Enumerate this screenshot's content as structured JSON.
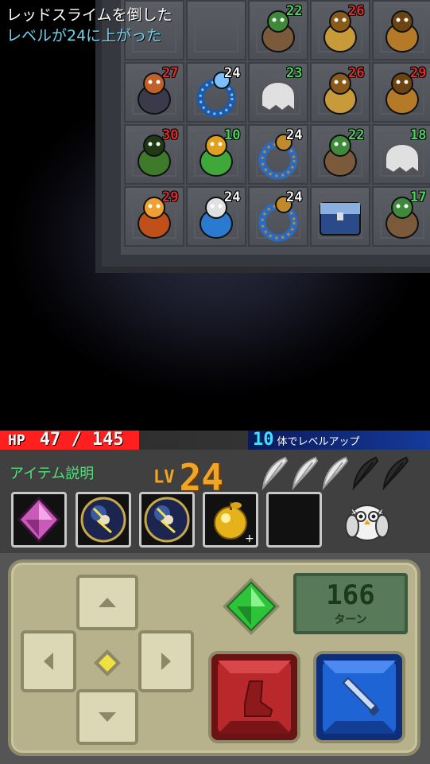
{
  "log": [
    "レッドスライムを倒した",
    "レベルが24に上がった"
  ],
  "board": {
    "monsters": [
      {
        "name": "ratman",
        "num": "22",
        "color": "green",
        "col": 2,
        "row": 0
      },
      {
        "name": "owlbear",
        "num": "26",
        "color": "red",
        "col": 3,
        "row": 0
      },
      {
        "name": "mud-slime",
        "num": "",
        "color": "",
        "col": 4,
        "row": 0
      },
      {
        "name": "dark-knight",
        "num": "27",
        "color": "red",
        "col": 0,
        "row": 1
      },
      {
        "name": "sea-serpent",
        "num": "24",
        "color": "white",
        "col": 1,
        "row": 1
      },
      {
        "name": "ghost",
        "num": "23",
        "color": "green",
        "col": 2,
        "row": 1
      },
      {
        "name": "owlbear",
        "num": "26",
        "color": "red",
        "col": 3,
        "row": 1
      },
      {
        "name": "mud-slime",
        "num": "29",
        "color": "red",
        "col": 4,
        "row": 1
      },
      {
        "name": "hooded-mage",
        "num": "30",
        "color": "red",
        "col": 0,
        "row": 2
      },
      {
        "name": "green-frog",
        "num": "10",
        "color": "green",
        "col": 1,
        "row": 2
      },
      {
        "name": "snail",
        "num": "24",
        "color": "white",
        "col": 2,
        "row": 2
      },
      {
        "name": "ratman",
        "num": "22",
        "color": "green",
        "col": 3,
        "row": 2
      },
      {
        "name": "ghost",
        "num": "18",
        "color": "green",
        "col": 4,
        "row": 2
      },
      {
        "name": "fire-golem",
        "num": "29",
        "color": "red",
        "col": 0,
        "row": 3
      },
      {
        "name": "hero",
        "num": "24",
        "color": "white",
        "col": 1,
        "row": 3
      },
      {
        "name": "snail",
        "num": "24",
        "color": "white",
        "col": 2,
        "row": 3
      },
      {
        "name": "treasure-chest",
        "num": "",
        "color": "",
        "col": 3,
        "row": 3
      },
      {
        "name": "ratman",
        "num": "17",
        "color": "green",
        "col": 4,
        "row": 3
      }
    ]
  },
  "status": {
    "hp_label": "HP",
    "hp_current": "47",
    "hp_sep": "/",
    "hp_max": "145",
    "hp_fraction": 0.324,
    "levelup_count": "10",
    "levelup_text": "体でレベルアップ"
  },
  "info": {
    "item_desc": "アイテム説明",
    "lv_label": "LV",
    "lv_value": "24",
    "feathers_total": 5,
    "feathers_active": 3,
    "items": [
      {
        "name": "pink-crystal"
      },
      {
        "name": "thunder-orb"
      },
      {
        "name": "thunder-orb"
      },
      {
        "name": "golden-apple",
        "badge": "+"
      },
      {
        "name": "empty"
      }
    ]
  },
  "controls": {
    "turns_value": "166",
    "turns_label": "ターン",
    "colors": {
      "panel": "#b7b28c",
      "kick": "#b9292b",
      "attack": "#1f64d4",
      "gem": "#2ec43a"
    }
  }
}
